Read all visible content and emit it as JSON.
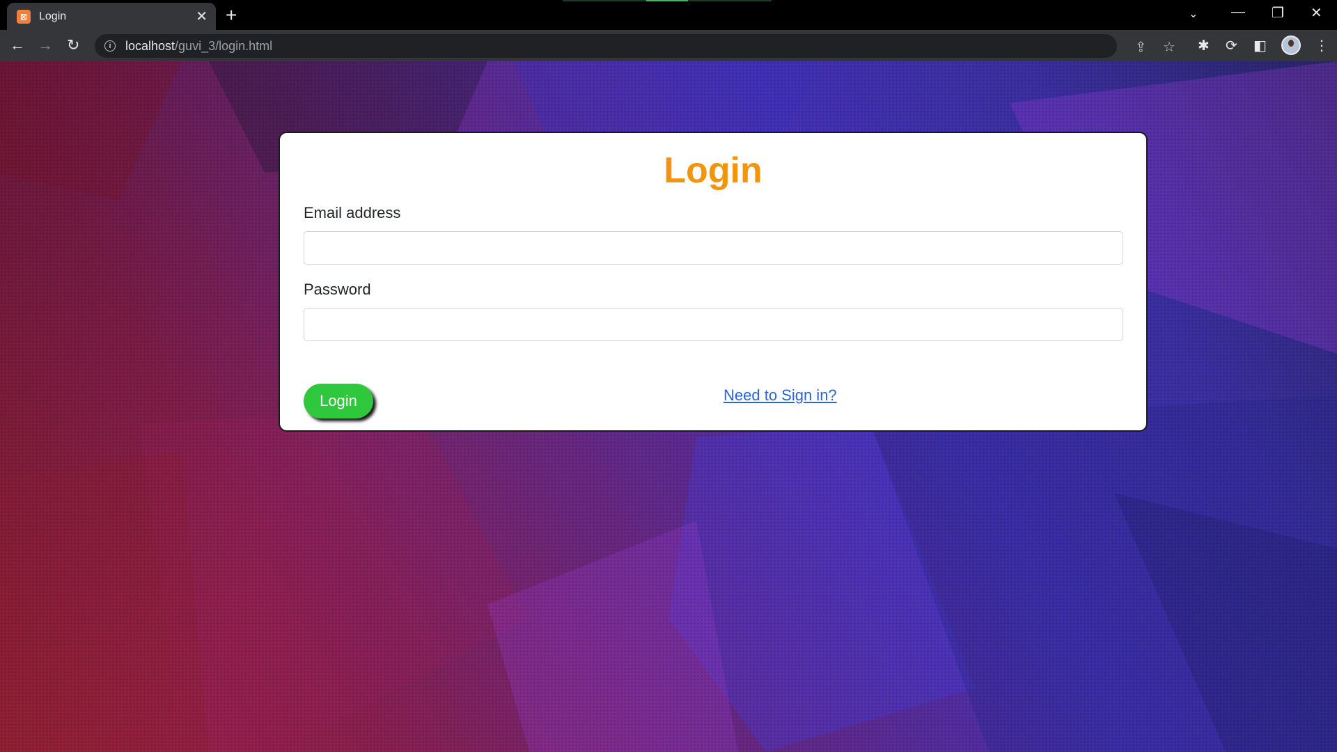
{
  "browser": {
    "tab_title": "Login",
    "tab_favicon": "xampp-icon",
    "tab_close_glyph": "✕",
    "new_tab_glyph": "+",
    "url_host": "localhost",
    "url_path": "/guvi_3/login.html",
    "icons": [
      "back-icon",
      "forward-icon",
      "reload-icon",
      "info-icon",
      "share-icon",
      "star-icon",
      "extensions-icon",
      "refresh-extension-icon",
      "sidebar-icon",
      "avatar",
      "menu-icon",
      "tab-search-icon",
      "minimize-icon",
      "restore-icon",
      "close-window-icon"
    ]
  },
  "page": {
    "title": "Login",
    "email_label": "Email address",
    "email_value": "",
    "password_label": "Password",
    "password_value": "",
    "login_button": "Login",
    "signin_link": "Need to Sign in?",
    "colors": {
      "title": "#f0950d",
      "button": "#2fc83c",
      "link": "#2a63d6"
    }
  }
}
